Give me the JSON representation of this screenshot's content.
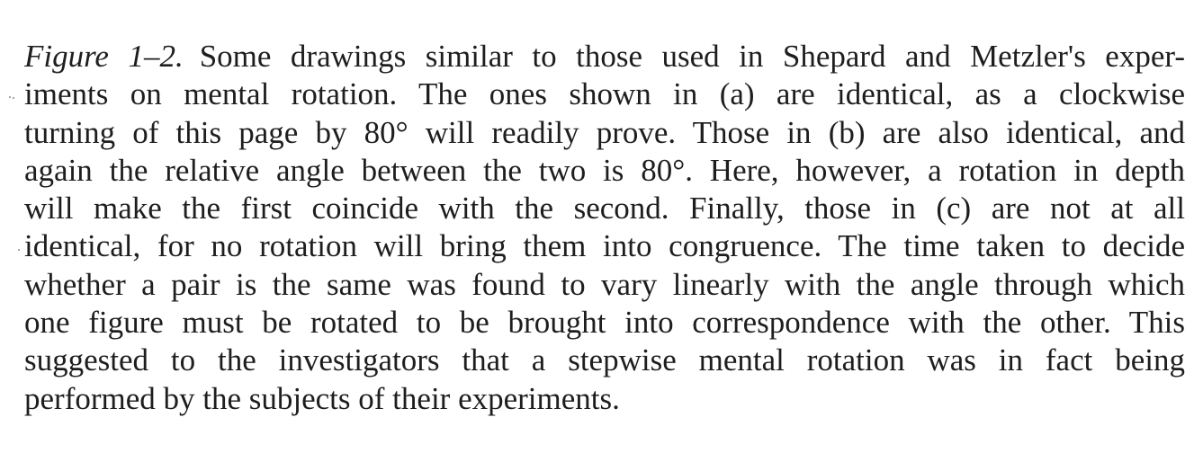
{
  "caption": {
    "label": "Figure 1–2.",
    "lines": [
      "Some drawings similar to those used in Shepard and Metzler's exper-",
      "iments on mental rotation. The ones shown in (a) are identical, as a clockwise",
      "turning of this page by 80° will readily prove. Those in (b) are also identical, and",
      "again the relative angle between the two is 80°. Here, however, a rotation in depth",
      "will make the first coincide with the second. Finally, those in (c) are not at all",
      "identical, for no rotation will bring them into congruence. The time taken to decide",
      "whether a pair is the same was found to vary linearly with the angle through which",
      "one figure must be rotated to be brought into correspondence with the other. This",
      "suggested to the investigators that a stepwise mental rotation was in fact being",
      "performed by the subjects of their experiments."
    ]
  }
}
